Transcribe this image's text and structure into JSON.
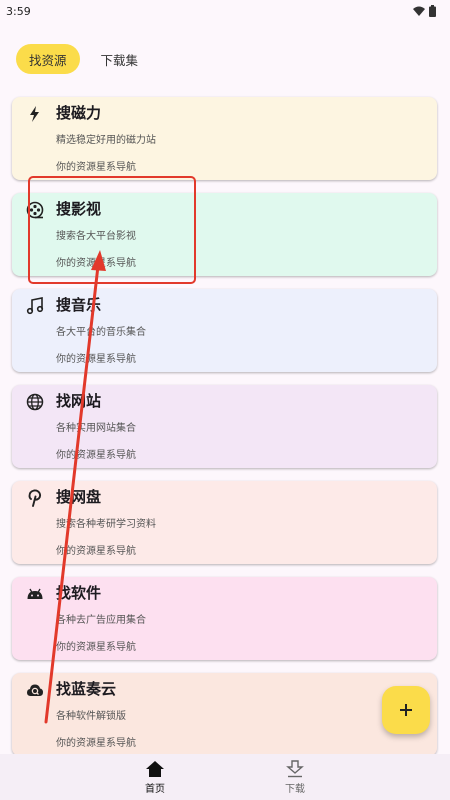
{
  "status": {
    "time": "3:59",
    "wifi_icon": "wifi-icon",
    "battery_icon": "battery-icon"
  },
  "tabs": [
    {
      "label": "找资源",
      "active": true
    },
    {
      "label": "下载集",
      "active": false
    }
  ],
  "cards": [
    {
      "title": "搜磁力",
      "desc": "精选稳定好用的磁力站",
      "foot": "你的资源星系导航",
      "icon": "bolt-icon",
      "color": "#fdf5e1"
    },
    {
      "title": "搜影视",
      "desc": "搜索各大平台影视",
      "foot": "你的资源星系导航",
      "icon": "film-reel-icon",
      "color": "#e0f9ee"
    },
    {
      "title": "搜音乐",
      "desc": "各大平台的音乐集合",
      "foot": "你的资源星系导航",
      "icon": "music-note-icon",
      "color": "#edf0fc"
    },
    {
      "title": "找网站",
      "desc": "各种实用网站集合",
      "foot": "你的资源星系导航",
      "icon": "globe-icon",
      "color": "#f3e6f6"
    },
    {
      "title": "搜网盘",
      "desc": "搜索各种考研学习资料",
      "foot": "你的资源星系导航",
      "icon": "pinterest-icon",
      "color": "#fdeae8"
    },
    {
      "title": "找软件",
      "desc": "各种去广告应用集合",
      "foot": "你的资源星系导航",
      "icon": "android-icon",
      "color": "#fde0f0"
    },
    {
      "title": "找蓝奏云",
      "desc": "各种软件解锁版",
      "foot": "你的资源星系导航",
      "icon": "cloud-icon",
      "color": "#fbe7df"
    }
  ],
  "fab": {
    "icon": "plus-icon"
  },
  "bottom_nav": [
    {
      "label": "首页",
      "icon": "home-icon",
      "active": true
    },
    {
      "label": "下载",
      "icon": "download-icon",
      "active": false
    }
  ],
  "colors": {
    "accent": "#fbdc4a",
    "annotation": "#e2392b",
    "background": "#fdf7fc"
  }
}
